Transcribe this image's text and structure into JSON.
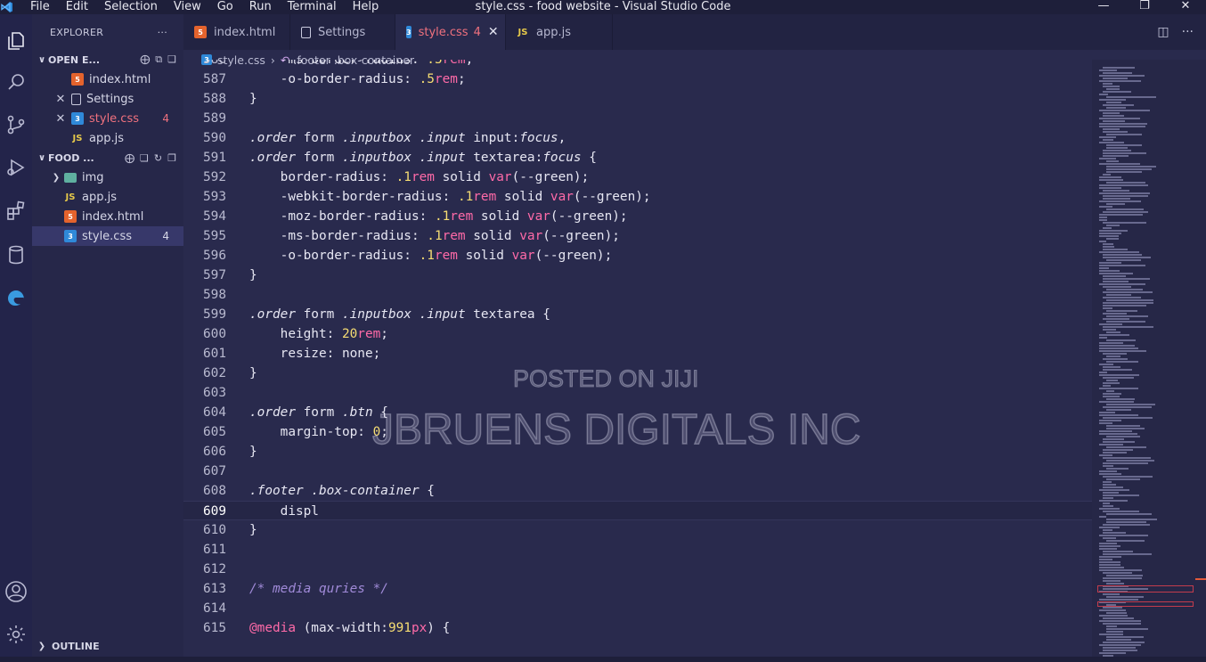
{
  "titlebar": {
    "menu": [
      "File",
      "Edit",
      "Selection",
      "View",
      "Go",
      "Run",
      "Terminal",
      "Help"
    ],
    "window_title": "style.css - food website - Visual Studio Code"
  },
  "activity_bar": {
    "icons": [
      "explorer-icon",
      "search-icon",
      "source-control-icon",
      "run-debug-icon",
      "extensions-icon",
      "database-icon",
      "edge-icon",
      "account-icon",
      "settings-gear-icon"
    ]
  },
  "sidebar": {
    "title": "EXPLORER",
    "more": "···",
    "open_editors": {
      "label": "OPEN E...",
      "items": [
        {
          "name": "index.html",
          "icon": "html-file-icon",
          "closable": false,
          "badge": "",
          "error": false
        },
        {
          "name": "Settings",
          "icon": "settings-file-icon",
          "closable": true,
          "badge": "",
          "error": false
        },
        {
          "name": "style.css",
          "icon": "css-file-icon",
          "closable": true,
          "badge": "4",
          "error": true
        },
        {
          "name": "app.js",
          "icon": "js-file-icon",
          "closable": false,
          "badge": "",
          "error": false
        }
      ]
    },
    "folder": {
      "label": "FOOD ...",
      "items": [
        {
          "name": "img",
          "icon": "folder-icon",
          "badge": ""
        },
        {
          "name": "app.js",
          "icon": "js-file-icon",
          "badge": ""
        },
        {
          "name": "index.html",
          "icon": "html-file-icon",
          "badge": ""
        },
        {
          "name": "style.css",
          "icon": "css-file-icon",
          "badge": "4"
        }
      ]
    },
    "outline_label": "OUTLINE"
  },
  "tabs": [
    {
      "label": "index.html",
      "icon": "html-file-icon",
      "active": false,
      "count": ""
    },
    {
      "label": "Settings",
      "icon": "settings-file-icon",
      "active": false,
      "count": ""
    },
    {
      "label": "style.css",
      "icon": "css-file-icon",
      "active": true,
      "count": "4"
    },
    {
      "label": "app.js",
      "icon": "js-file-icon",
      "active": false,
      "count": ""
    }
  ],
  "breadcrumb": {
    "file": "style.css",
    "symbol": ".footer .box-container"
  },
  "editor": {
    "current_line": 609,
    "lines": [
      {
        "n": "586",
        "code": "    -ms-border-radius: .5rem;"
      },
      {
        "n": "587",
        "code": "    -o-border-radius: .5rem;"
      },
      {
        "n": "588",
        "code": "}"
      },
      {
        "n": "589",
        "code": ""
      },
      {
        "n": "590",
        "code": ".order form .inputbox .input input:focus,"
      },
      {
        "n": "591",
        "code": ".order form .inputbox .input textarea:focus {"
      },
      {
        "n": "592",
        "code": "    border-radius: .1rem solid var(--green);"
      },
      {
        "n": "593",
        "code": "    -webkit-border-radius: .1rem solid var(--green);"
      },
      {
        "n": "594",
        "code": "    -moz-border-radius: .1rem solid var(--green);"
      },
      {
        "n": "595",
        "code": "    -ms-border-radius: .1rem solid var(--green);"
      },
      {
        "n": "596",
        "code": "    -o-border-radius: .1rem solid var(--green);"
      },
      {
        "n": "597",
        "code": "}"
      },
      {
        "n": "598",
        "code": ""
      },
      {
        "n": "599",
        "code": ".order form .inputbox .input textarea {"
      },
      {
        "n": "600",
        "code": "    height: 20rem;"
      },
      {
        "n": "601",
        "code": "    resize: none;"
      },
      {
        "n": "602",
        "code": "}"
      },
      {
        "n": "603",
        "code": ""
      },
      {
        "n": "604",
        "code": ".order form .btn {"
      },
      {
        "n": "605",
        "code": "    margin-top: 0;"
      },
      {
        "n": "606",
        "code": "}"
      },
      {
        "n": "607",
        "code": ""
      },
      {
        "n": "608",
        "code": ".footer .box-container {"
      },
      {
        "n": "609",
        "code": "    displ"
      },
      {
        "n": "610",
        "code": "}"
      },
      {
        "n": "611",
        "code": ""
      },
      {
        "n": "612",
        "code": ""
      },
      {
        "n": "613",
        "code": "/* media quries */"
      },
      {
        "n": "614",
        "code": ""
      },
      {
        "n": "615",
        "code": "@media (max-width:991px) {"
      }
    ]
  },
  "watermark": {
    "line1": "POSTED ON JIJI",
    "line2": "JBRUENS DIGITALS INC"
  },
  "colors": {
    "editor_bg": "#292a4d",
    "sidebar_bg": "#262749",
    "error": "#f0717e",
    "keyword": "#ff6aa8",
    "number": "#f6dd73",
    "comment": "#a08ad8"
  }
}
